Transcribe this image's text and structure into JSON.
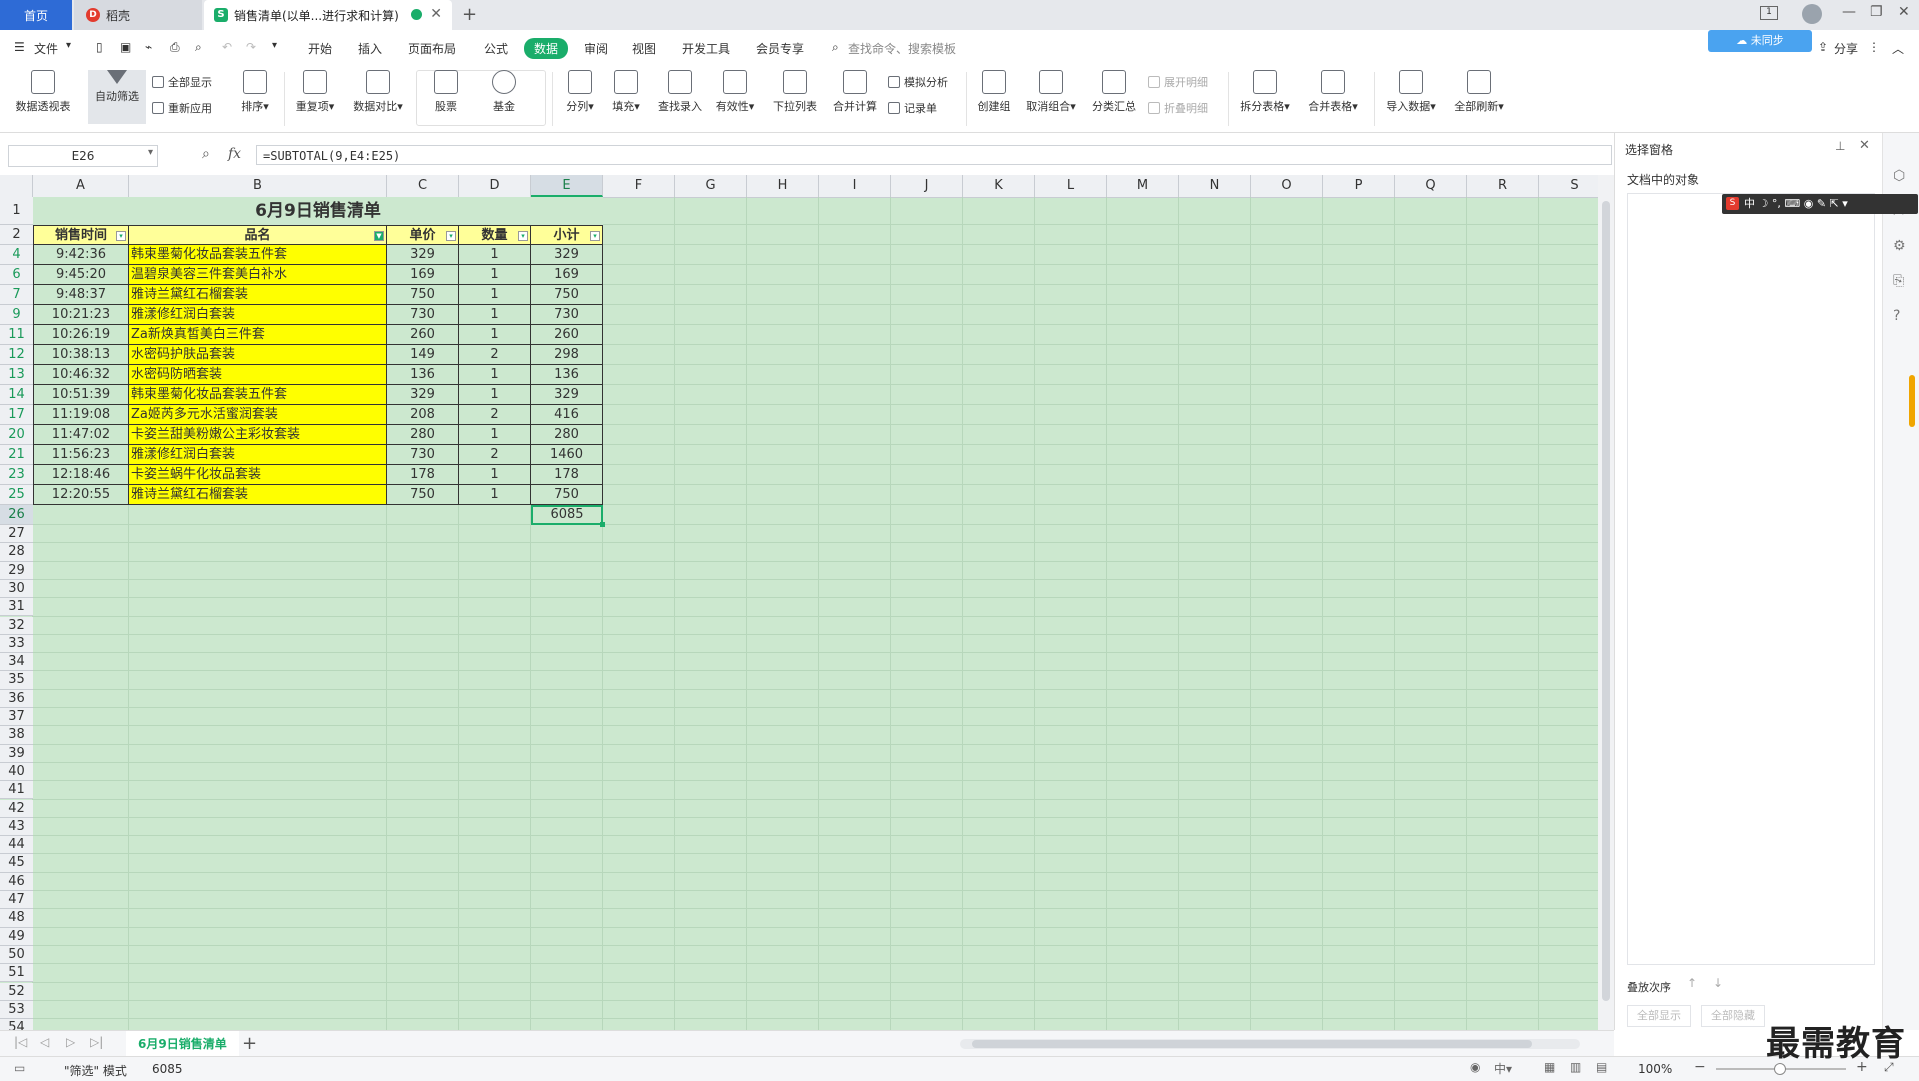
{
  "titlebar": {
    "tabs": [
      {
        "label": "首页"
      },
      {
        "label": "稻壳"
      },
      {
        "label": "销售清单(以单...进行求和计算)"
      }
    ]
  },
  "menubar": {
    "file": "文件",
    "items": [
      "开始",
      "插入",
      "页面布局",
      "公式",
      "数据",
      "审阅",
      "视图",
      "开发工具",
      "会员专享"
    ],
    "search_placeholder": "查找命令、搜索模板",
    "share": "分享",
    "cloud": "未同步"
  },
  "ribbon": {
    "pivot": "数据透视表",
    "autofilter": "自动筛选",
    "showall": "全部显示",
    "reapply": "重新应用",
    "sort": "排序",
    "dup": "重复项",
    "compare": "数据对比",
    "stock": "股票",
    "fund": "基金",
    "split": "分列",
    "fill": "填充",
    "lookup": "查找录入",
    "valid": "有效性",
    "dropdown": "下拉列表",
    "consolidate": "合并计算",
    "whatif": "模拟分析",
    "record": "记录单",
    "group": "创建组",
    "ungroup": "取消组合",
    "subtotal": "分类汇总",
    "expand": "展开明细",
    "collapse": "折叠明细",
    "splittable": "拆分表格",
    "mergetable": "合并表格",
    "import": "导入数据",
    "refresh": "全部刷新"
  },
  "formula_bar": {
    "cell_ref": "E26",
    "fx": "fx",
    "formula": "=SUBTOTAL(9,E4:E25)"
  },
  "grid": {
    "columns": [
      "A",
      "B",
      "C",
      "D",
      "E",
      "F",
      "G",
      "H",
      "I",
      "J",
      "K",
      "L",
      "M",
      "N",
      "O",
      "P",
      "Q",
      "R",
      "S"
    ],
    "title": "6月9日销售清单",
    "headers": [
      "销售时间",
      "品名",
      "单价",
      "数量",
      "小计"
    ],
    "rows": [
      {
        "row": "4",
        "time": "9:42:36",
        "name": "韩束墨菊化妆品套装五件套",
        "price": "329",
        "qty": "1",
        "sub": "329"
      },
      {
        "row": "6",
        "time": "9:45:20",
        "name": "温碧泉美容三件套美白补水",
        "price": "169",
        "qty": "1",
        "sub": "169"
      },
      {
        "row": "7",
        "time": "9:48:37",
        "name": "雅诗兰黛红石榴套装",
        "price": "750",
        "qty": "1",
        "sub": "750"
      },
      {
        "row": "9",
        "time": "10:21:23",
        "name": "雅漾修红润白套装",
        "price": "730",
        "qty": "1",
        "sub": "730"
      },
      {
        "row": "11",
        "time": "10:26:19",
        "name": "Za新焕真皙美白三件套",
        "price": "260",
        "qty": "1",
        "sub": "260"
      },
      {
        "row": "12",
        "time": "10:38:13",
        "name": "水密码护肤品套装",
        "price": "149",
        "qty": "2",
        "sub": "298"
      },
      {
        "row": "13",
        "time": "10:46:32",
        "name": "水密码防晒套装",
        "price": "136",
        "qty": "1",
        "sub": "136"
      },
      {
        "row": "14",
        "time": "10:51:39",
        "name": "韩束墨菊化妆品套装五件套",
        "price": "329",
        "qty": "1",
        "sub": "329"
      },
      {
        "row": "17",
        "time": "11:19:08",
        "name": "Za姬芮多元水活蜜润套装",
        "price": "208",
        "qty": "2",
        "sub": "416"
      },
      {
        "row": "20",
        "time": "11:47:02",
        "name": "卡姿兰甜美粉嫩公主彩妆套装",
        "price": "280",
        "qty": "1",
        "sub": "280"
      },
      {
        "row": "21",
        "time": "11:56:23",
        "name": "雅漾修红润白套装",
        "price": "730",
        "qty": "2",
        "sub": "1460"
      },
      {
        "row": "23",
        "time": "12:18:46",
        "name": "卡姿兰蜗牛化妆品套装",
        "price": "178",
        "qty": "1",
        "sub": "178"
      },
      {
        "row": "25",
        "time": "12:20:55",
        "name": "雅诗兰黛红石榴套装",
        "price": "750",
        "qty": "1",
        "sub": "750"
      }
    ],
    "total_row": "26",
    "total": "6085",
    "empty_rows": [
      "27",
      "28",
      "29",
      "30",
      "31",
      "32",
      "33",
      "34",
      "35",
      "36",
      "37",
      "38",
      "39",
      "40",
      "41",
      "42",
      "43",
      "44",
      "45",
      "46",
      "47",
      "48",
      "49",
      "50",
      "51",
      "52",
      "53",
      "54"
    ]
  },
  "sheet_tabs": {
    "active": "6月9日销售清单"
  },
  "right_pane": {
    "title": "选择窗格",
    "objects_label": "文档中的对象",
    "order_label": "叠放次序",
    "show_all": "全部显示",
    "hide_all": "全部隐藏"
  },
  "statusbar": {
    "mode": "\"筛选\" 模式",
    "sum": "6085",
    "zoom": "100%"
  },
  "watermark": "最需教育",
  "colors": {
    "accent": "#1aad6a",
    "grid_bg": "#cce8cf",
    "cell_yellow": "#ffff00",
    "tab_blue": "#2e6bd6"
  }
}
